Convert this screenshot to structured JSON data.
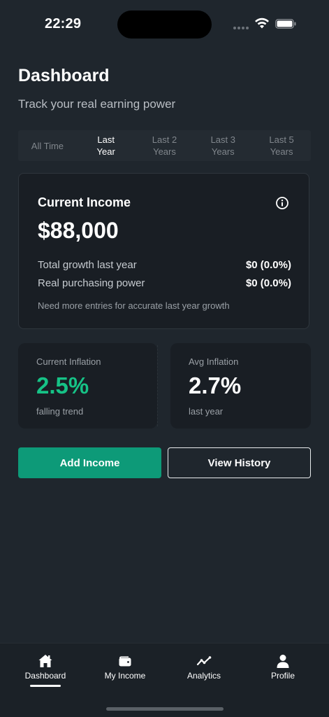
{
  "status_bar": {
    "time": "22:29"
  },
  "header": {
    "title": "Dashboard",
    "subtitle": "Track your real earning power"
  },
  "period_tabs": [
    {
      "label": "All Time",
      "active": false
    },
    {
      "label": "Last Year",
      "active": true
    },
    {
      "label": "Last 2 Years",
      "active": false
    },
    {
      "label": "Last 3 Years",
      "active": false
    },
    {
      "label": "Last 5 Years",
      "active": false
    }
  ],
  "income_card": {
    "title": "Current Income",
    "amount": "$88,000",
    "growth_label": "Total growth last year",
    "growth_value": "$0 (0.0%)",
    "power_label": "Real purchasing power",
    "power_value": "$0 (0.0%)",
    "note": "Need more entries for accurate last year growth"
  },
  "stats": {
    "current_inflation": {
      "label": "Current Inflation",
      "value": "2.5%",
      "sub": "falling trend"
    },
    "avg_inflation": {
      "label": "Avg Inflation",
      "value": "2.7%",
      "sub": "last year"
    }
  },
  "actions": {
    "add_income": "Add Income",
    "view_history": "View History"
  },
  "nav": [
    {
      "label": "Dashboard",
      "icon": "home-icon",
      "active": true
    },
    {
      "label": "My Income",
      "icon": "wallet-icon",
      "active": false
    },
    {
      "label": "Analytics",
      "icon": "trend-icon",
      "active": false
    },
    {
      "label": "Profile",
      "icon": "person-icon",
      "active": false
    }
  ],
  "colors": {
    "background": "#1f262d",
    "card": "#191e24",
    "accent_green": "#16c286",
    "primary_button": "#0d9a78"
  }
}
